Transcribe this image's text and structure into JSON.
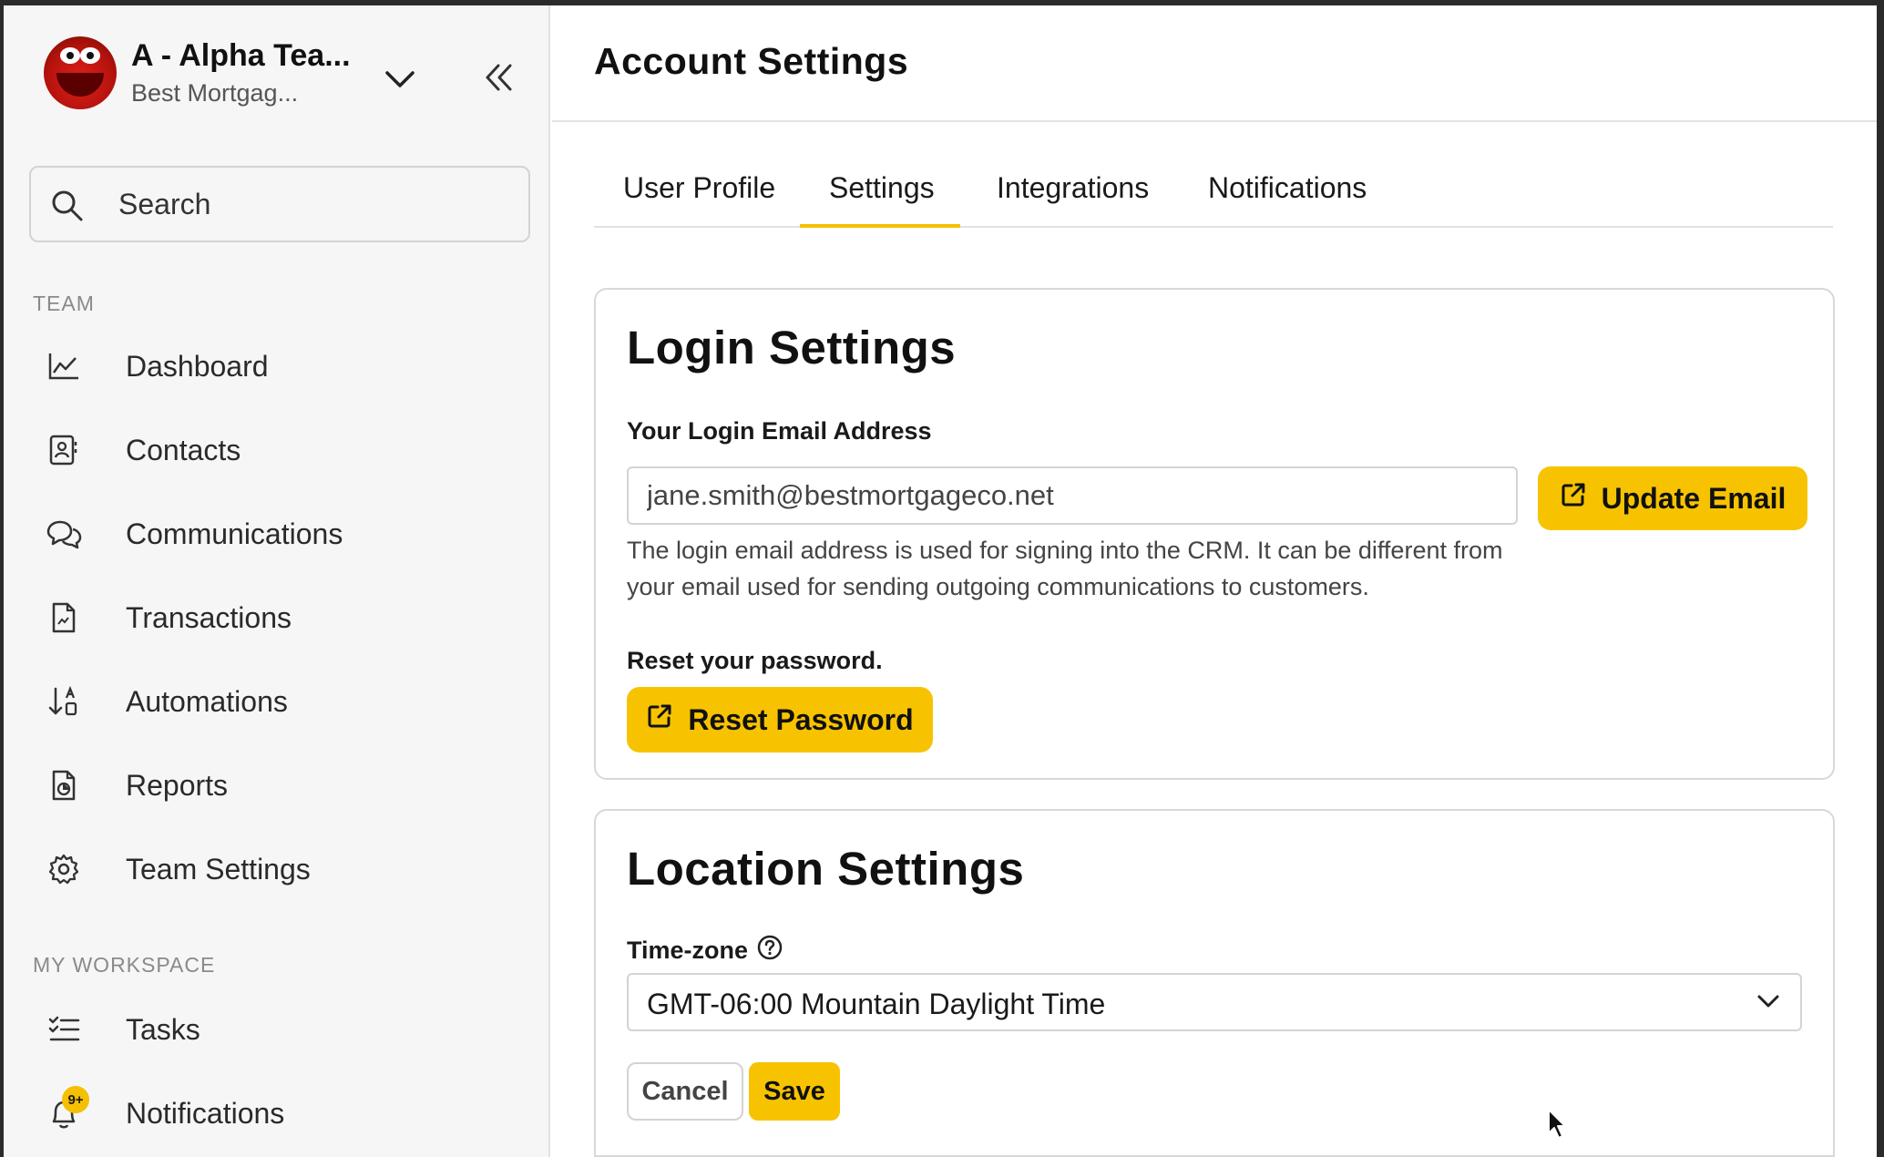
{
  "sidebar": {
    "team_name": "A - Alpha Tea...",
    "team_sub": "Best Mortgag...",
    "search": {
      "placeholder": "Search"
    },
    "section_team": "TEAM",
    "section_workspace": "MY WORKSPACE",
    "items": [
      {
        "label": "Dashboard",
        "icon": "chart-line-icon"
      },
      {
        "label": "Contacts",
        "icon": "contact-card-icon"
      },
      {
        "label": "Communications",
        "icon": "chat-bubbles-icon"
      },
      {
        "label": "Transactions",
        "icon": "document-icon"
      },
      {
        "label": "Automations",
        "icon": "sort-icon"
      },
      {
        "label": "Reports",
        "icon": "report-icon"
      },
      {
        "label": "Team Settings",
        "icon": "gear-icon"
      }
    ],
    "workspace_items": [
      {
        "label": "Tasks",
        "icon": "task-list-icon"
      },
      {
        "label": "Notifications",
        "icon": "bell-icon",
        "badge": "9+"
      }
    ]
  },
  "header": {
    "title": "Account Settings"
  },
  "tabs": [
    {
      "label": "User Profile",
      "active": false
    },
    {
      "label": "Settings",
      "active": true
    },
    {
      "label": "Integrations",
      "active": false
    },
    {
      "label": "Notifications",
      "active": false
    }
  ],
  "login": {
    "title": "Login Settings",
    "email_label": "Your Login Email Address",
    "email_value": "jane.smith@bestmortgageco.net",
    "update_email_label": "Update Email",
    "help_text": "The login email address is used for signing into the CRM. It can be different from your email used for sending outgoing communications to customers.",
    "reset_label": "Reset your password.",
    "reset_button": "Reset Password"
  },
  "location": {
    "title": "Location Settings",
    "timezone_label": "Time-zone",
    "timezone_value": "GMT-06:00 Mountain Daylight Time",
    "cancel_label": "Cancel",
    "save_label": "Save"
  },
  "colors": {
    "accent": "#f7c300",
    "sidebar_bg": "#f6f6f6",
    "border": "#d8d8d8"
  }
}
